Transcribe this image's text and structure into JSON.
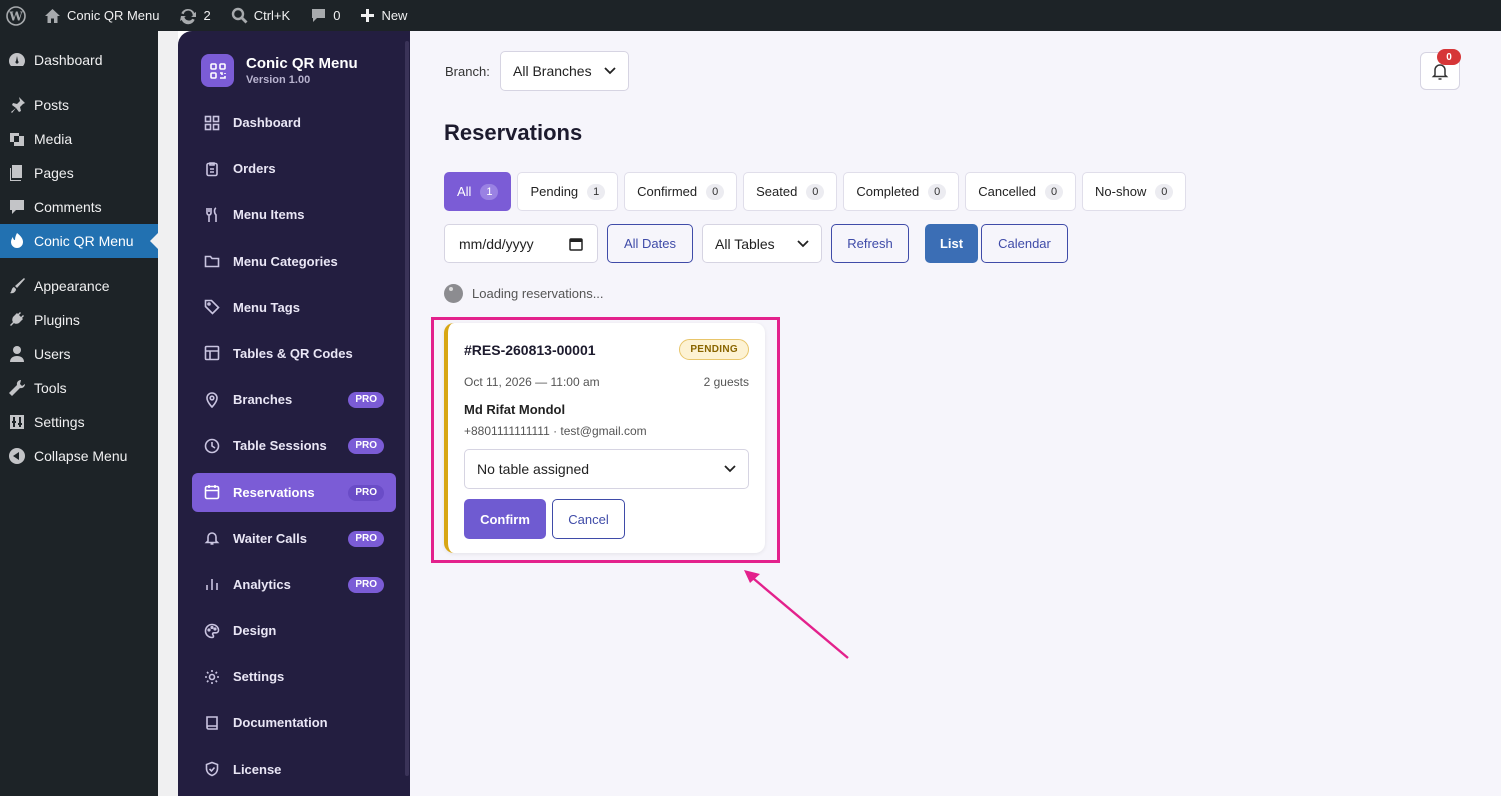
{
  "admin_bar": {
    "site_name": "Conic QR Menu",
    "updates_count": "2",
    "search_shortcut": "Ctrl+K",
    "comments_count": "0",
    "new_label": "New"
  },
  "wp_menu": {
    "items": [
      {
        "label": "Dashboard",
        "icon": "dashboard-icon"
      },
      {
        "label": "Posts",
        "icon": "pin-icon"
      },
      {
        "label": "Media",
        "icon": "media-icon"
      },
      {
        "label": "Pages",
        "icon": "pages-icon"
      },
      {
        "label": "Comments",
        "icon": "comment-icon"
      },
      {
        "label": "Conic QR Menu",
        "icon": "plugin-icon",
        "active": true
      },
      {
        "label": "Appearance",
        "icon": "brush-icon"
      },
      {
        "label": "Plugins",
        "icon": "plug-icon"
      },
      {
        "label": "Users",
        "icon": "user-icon"
      },
      {
        "label": "Tools",
        "icon": "wrench-icon"
      },
      {
        "label": "Settings",
        "icon": "settings-icon"
      },
      {
        "label": "Collapse Menu",
        "icon": "collapse-icon"
      }
    ]
  },
  "plugin": {
    "name": "Conic QR Menu",
    "version": "Version 1.00",
    "pro_label": "PRO",
    "nav": [
      {
        "label": "Dashboard",
        "icon": "grid-icon",
        "pro": false
      },
      {
        "label": "Orders",
        "icon": "clipboard-icon",
        "pro": false
      },
      {
        "label": "Menu Items",
        "icon": "utensils-icon",
        "pro": false
      },
      {
        "label": "Menu Categories",
        "icon": "folder-icon",
        "pro": false
      },
      {
        "label": "Menu Tags",
        "icon": "tag-icon",
        "pro": false
      },
      {
        "label": "Tables & QR Codes",
        "icon": "table-icon",
        "pro": false
      },
      {
        "label": "Branches",
        "icon": "map-pin-icon",
        "pro": true
      },
      {
        "label": "Table Sessions",
        "icon": "clock-icon",
        "pro": true
      },
      {
        "label": "Reservations",
        "icon": "calendar-icon",
        "pro": true,
        "active": true
      },
      {
        "label": "Waiter Calls",
        "icon": "bell-icon",
        "pro": true
      },
      {
        "label": "Analytics",
        "icon": "bar-chart-icon",
        "pro": true
      },
      {
        "label": "Design",
        "icon": "palette-icon",
        "pro": false
      },
      {
        "label": "Settings",
        "icon": "gear-icon",
        "pro": false
      },
      {
        "label": "Documentation",
        "icon": "book-icon",
        "pro": false
      },
      {
        "label": "License",
        "icon": "shield-icon",
        "pro": false
      }
    ]
  },
  "header": {
    "branch_label": "Branch:",
    "branch_value": "All Branches",
    "notifications_count": "0"
  },
  "page_title": "Reservations",
  "status_tabs": [
    {
      "label": "All",
      "count": "1",
      "active": true
    },
    {
      "label": "Pending",
      "count": "1"
    },
    {
      "label": "Confirmed",
      "count": "0"
    },
    {
      "label": "Seated",
      "count": "0"
    },
    {
      "label": "Completed",
      "count": "0"
    },
    {
      "label": "Cancelled",
      "count": "0"
    },
    {
      "label": "No-show",
      "count": "0"
    }
  ],
  "filters": {
    "date_placeholder": "mm/dd/yyyy",
    "all_dates": "All Dates",
    "tables_value": "All Tables",
    "refresh": "Refresh",
    "view_list": "List",
    "view_calendar": "Calendar"
  },
  "loading_text": "Loading reservations...",
  "reservation": {
    "id": "#RES-260813-00001",
    "status": "PENDING",
    "datetime": "Oct 11, 2026 — 11:00 am",
    "guests": "2 guests",
    "name": "Md Rifat Mondol",
    "contact": "+8801111111111 · test@gmail.com",
    "table_value": "No table assigned",
    "confirm": "Confirm",
    "cancel": "Cancel"
  },
  "colors": {
    "accent": "#7b5cd6",
    "plugin_sidebar": "#231e40",
    "wp_active": "#2271b1",
    "pending_border": "#d8a614",
    "highlight": "#e3218c"
  }
}
